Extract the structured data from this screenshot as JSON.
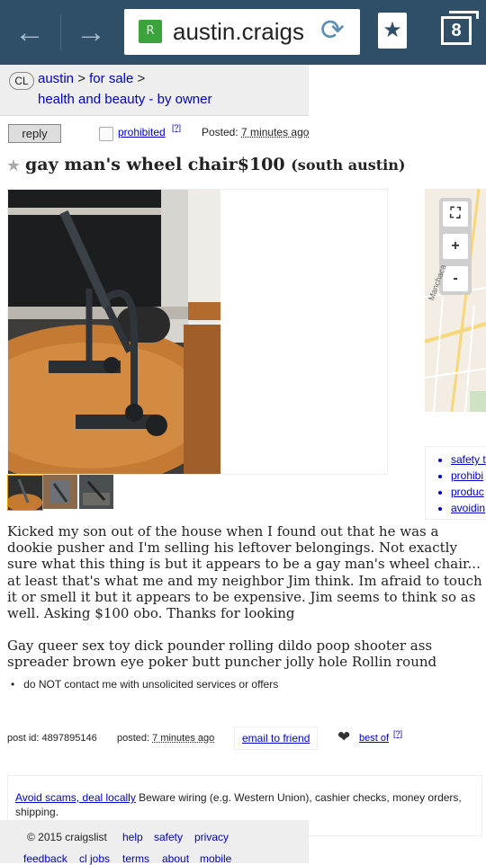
{
  "browser": {
    "url": "austin.craigs",
    "tab_count": "8",
    "favicon_letter": "R"
  },
  "breadcrumb": {
    "logo": "CL",
    "city": "austin",
    "section": "for sale",
    "category": "health and beauty - by owner"
  },
  "post_header": {
    "reply_label": "reply",
    "prohibited_label": "prohibited",
    "prohibited_help": "[?]",
    "posted_label": "Posted:",
    "posted_time": "7 minutes ago"
  },
  "posting": {
    "title": "gay man's wheel chair",
    "price": "$100",
    "location": "(south austin)",
    "body_paragraph_1": "Kicked my son out of the house when I found out that he was a dookie pusher and I'm selling his leftover belongings. Not exactly sure what this thing is but it appears to be a gay man's wheel chair... at least that's what me and my neighbor Jim think. Im afraid to touch it or smell it but it appears to be expensive. Jim seems to think so as well. Asking $100 obo. Thanks for looking",
    "body_paragraph_2": "Gay queer sex toy dick pounder rolling dildo poop shooter ass spreader brown eye poker butt puncher jolly hole Rollin round",
    "notice": "do NOT contact me with unsolicited services or offers"
  },
  "map_controls": {
    "fullscreen": "⛶",
    "zoom_in": "+",
    "zoom_out": "-",
    "street_label": "Manchaca"
  },
  "safety_links": [
    "safety t",
    "prohibi",
    "produc",
    "avoidin"
  ],
  "post_footer": {
    "post_id": "post id: 4897895146",
    "posted_label": "posted:",
    "posted_time": "7 minutes ago",
    "email_label": "email to friend",
    "best_of_label": "best of",
    "best_of_help": "[?]"
  },
  "scam_notice": {
    "link": "Avoid scams, deal locally",
    "text": " Beware wiring (e.g. Western Union), cashier checks, money orders, shipping."
  },
  "footer": {
    "copyright": "© 2015 craigslist",
    "links_row1": [
      "help",
      "safety",
      "privacy"
    ],
    "links_row2": [
      "feedback",
      "cl jobs",
      "terms",
      "about",
      "mobile"
    ]
  }
}
